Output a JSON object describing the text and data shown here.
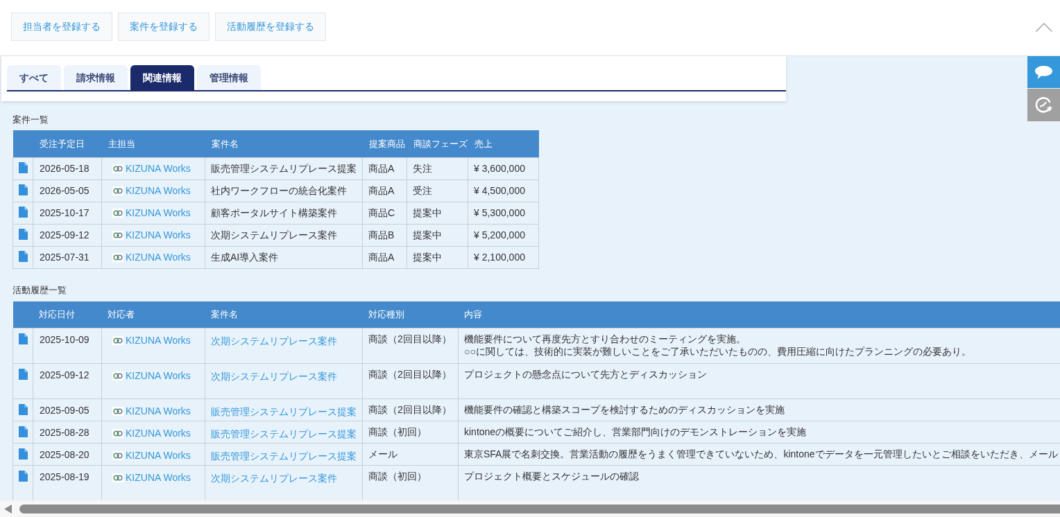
{
  "toolbar": {
    "buttons": [
      "担当者を登録する",
      "案件を登録する",
      "活動履歴を登録する"
    ]
  },
  "tabs": [
    {
      "label": "すべて",
      "selected": false
    },
    {
      "label": "請求情報",
      "selected": false
    },
    {
      "label": "関連情報",
      "selected": true
    },
    {
      "label": "管理情報",
      "selected": false
    }
  ],
  "deals": {
    "title": "案件一覧",
    "columns": [
      "受注予定日",
      "主担当",
      "案件名",
      "提案商品",
      "商談フェーズ",
      "売上"
    ],
    "rows": [
      {
        "date": "2026-05-18",
        "owner": "KIZUNA Works",
        "name": "販売管理システムリプレース提案",
        "product": "商品A",
        "phase": "失注",
        "sales": "¥ 3,600,000"
      },
      {
        "date": "2026-05-05",
        "owner": "KIZUNA Works",
        "name": "社内ワークフローの統合化案件",
        "product": "商品A",
        "phase": "受注",
        "sales": "¥ 4,500,000"
      },
      {
        "date": "2025-10-17",
        "owner": "KIZUNA Works",
        "name": "顧客ポータルサイト構築案件",
        "product": "商品C",
        "phase": "提案中",
        "sales": "¥ 5,300,000"
      },
      {
        "date": "2025-09-12",
        "owner": "KIZUNA Works",
        "name": "次期システムリプレース案件",
        "product": "商品B",
        "phase": "提案中",
        "sales": "¥ 5,200,000"
      },
      {
        "date": "2025-07-31",
        "owner": "KIZUNA Works",
        "name": "生成AI導入案件",
        "product": "商品A",
        "phase": "提案中",
        "sales": "¥ 2,100,000"
      }
    ]
  },
  "activities": {
    "title": "活動履歴一覧",
    "columns": [
      "対応日付",
      "対応者",
      "案件名",
      "対応種別",
      "内容"
    ],
    "rows": [
      {
        "date": "2025-10-09",
        "person": "KIZUNA Works",
        "deal": "次期システムリプレース案件",
        "type": "商談（2回目以降）",
        "content": "機能要件について再度先方とすり合わせのミーティングを実施。\n○○に関しては、技術的に実装が難しいことをご了承いただいたものの、費用圧縮に向けたプランニングの必要あり。"
      },
      {
        "date": "2025-09-12",
        "person": "KIZUNA Works",
        "deal": "次期システムリプレース案件",
        "type": "商談（2回目以降）",
        "content": "プロジェクトの懸念点について先方とディスカッション"
      },
      {
        "date": "2025-09-05",
        "person": "KIZUNA Works",
        "deal": "販売管理システムリプレース提案",
        "type": "商談（2回目以降）",
        "content": "機能要件の確認と構築スコープを検討するためのディスカッションを実施"
      },
      {
        "date": "2025-08-28",
        "person": "KIZUNA Works",
        "deal": "販売管理システムリプレース提案",
        "type": "商談（初回）",
        "content": "kintoneの概要についてご紹介し、営業部門向けのデモンストレーションを実施"
      },
      {
        "date": "2025-08-20",
        "person": "KIZUNA Works",
        "deal": "販売管理システムリプレース提案",
        "type": "メール",
        "content": "東京SFA展で名刺交換。営業活動の履歴をうまく管理できていないため、kintoneでデータを一元管理したいとご相談をいただき、メール"
      },
      {
        "date": "2025-08-19",
        "person": "KIZUNA Works",
        "deal": "次期システムリプレース案件",
        "type": "商談（初回）",
        "content": "プロジェクト概要とスケジュールの確認"
      }
    ]
  }
}
